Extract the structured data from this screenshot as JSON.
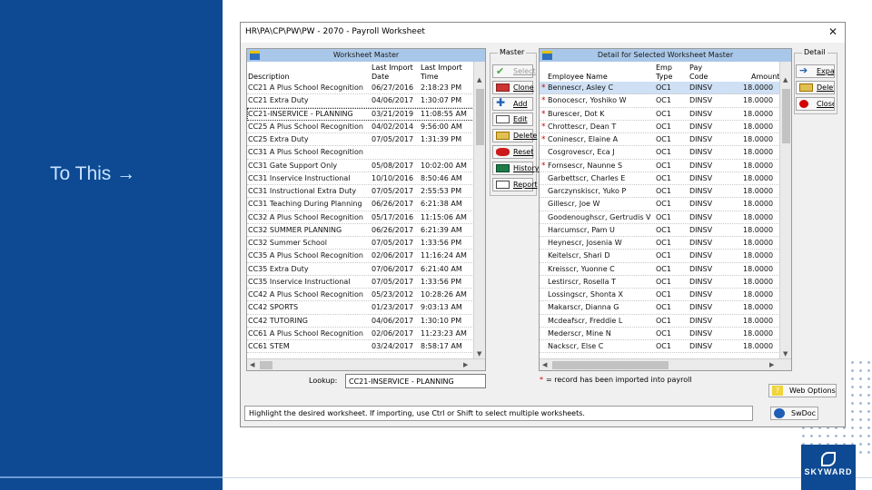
{
  "slide": {
    "caption": "To This",
    "arrow": "→",
    "logo_text": "SKYWARD"
  },
  "window": {
    "title": "HR\\PA\\CP\\PW\\PW - 2070 - Payroll Worksheet",
    "close": "✕"
  },
  "master": {
    "group_label": "Master",
    "grid_title": "Worksheet Master",
    "columns": {
      "description": "Description",
      "last_import_date": "Last Import Date",
      "last_import_time": "Last Import Time"
    },
    "rows": [
      {
        "description": "CC21 A Plus School Recognition",
        "date": "06/27/2016",
        "time": "2:18:23 PM"
      },
      {
        "description": "CC21 Extra Duty",
        "date": "04/06/2017",
        "time": "1:30:07 PM"
      },
      {
        "description": "CC21-INSERVICE - PLANNING",
        "date": "03/21/2019",
        "time": "11:08:55 AM"
      },
      {
        "description": "CC25 A Plus School Recognition",
        "date": "04/02/2014",
        "time": "9:56:00 AM"
      },
      {
        "description": "CC25 Extra Duty",
        "date": "07/05/2017",
        "time": "1:31:39 PM"
      },
      {
        "description": "CC31 A Plus School Recognition",
        "date": "",
        "time": ""
      },
      {
        "description": "CC31 Gate Support Only",
        "date": "05/08/2017",
        "time": "10:02:00 AM"
      },
      {
        "description": "CC31 Inservice Instructional",
        "date": "10/10/2016",
        "time": "8:50:46 AM"
      },
      {
        "description": "CC31 Instructional Extra Duty",
        "date": "07/05/2017",
        "time": "2:55:53 PM"
      },
      {
        "description": "CC31 Teaching During Planning",
        "date": "06/26/2017",
        "time": "6:21:38 AM"
      },
      {
        "description": "CC32 A Plus School Recognition",
        "date": "05/17/2016",
        "time": "11:15:06 AM"
      },
      {
        "description": "CC32 SUMMER PLANNING",
        "date": "06/26/2017",
        "time": "6:21:39 AM"
      },
      {
        "description": "CC32 Summer School",
        "date": "07/05/2017",
        "time": "1:33:56 PM"
      },
      {
        "description": "CC35 A Plus School Recognition",
        "date": "02/06/2017",
        "time": "11:16:24 AM"
      },
      {
        "description": "CC35 Extra Duty",
        "date": "07/06/2017",
        "time": "6:21:40 AM"
      },
      {
        "description": "CC35 Inservice Instructional",
        "date": "07/05/2017",
        "time": "1:33:56 PM"
      },
      {
        "description": "CC42 A Plus School Recognition",
        "date": "05/23/2012",
        "time": "10:28:26 AM"
      },
      {
        "description": "CC42 SPORTS",
        "date": "01/23/2017",
        "time": "9:03:13 AM"
      },
      {
        "description": "CC42 TUTORING",
        "date": "04/06/2017",
        "time": "1:30:10 PM"
      },
      {
        "description": "CC61 A Plus School Recognition",
        "date": "02/06/2017",
        "time": "11:23:23 AM"
      },
      {
        "description": "CC61 STEM",
        "date": "03/24/2017",
        "time": "8:58:17 AM"
      }
    ],
    "buttons": [
      {
        "name": "select-button",
        "label": "Select",
        "icon": "check-icon",
        "disabled": true
      },
      {
        "name": "clone-button",
        "label": "Clone",
        "icon": "clone-icon",
        "disabled": false
      },
      {
        "name": "add-button",
        "label": "Add",
        "icon": "plus-icon",
        "disabled": false
      },
      {
        "name": "edit-button",
        "label": "Edit",
        "icon": "pencil-icon",
        "disabled": false
      },
      {
        "name": "delete-button",
        "label": "Delete",
        "icon": "delete-icon",
        "disabled": false
      },
      {
        "name": "reset-button",
        "label": "Reset",
        "icon": "reset-icon",
        "disabled": false
      },
      {
        "name": "history-button",
        "label": "History",
        "icon": "history-icon",
        "disabled": false
      },
      {
        "name": "report-button",
        "label": "Report",
        "icon": "report-icon",
        "disabled": false
      }
    ],
    "lookup_label": "Lookup:",
    "lookup_value": "CC21-INSERVICE - PLANNING"
  },
  "detail": {
    "group_label": "Detail",
    "grid_title": "Detail for Selected Worksheet Master",
    "columns": {
      "employee_name": "Employee Name",
      "emp_type": "Emp Type",
      "pay_code": "Pay Code",
      "amount": "Amount"
    },
    "rows": [
      {
        "imported": true,
        "name": "Bennescr, Asley C",
        "type": "OC1",
        "code": "DINSV",
        "amount": "18.0000"
      },
      {
        "imported": true,
        "name": "Bonocescr, Yoshiko W",
        "type": "OC1",
        "code": "DINSV",
        "amount": "18.0000"
      },
      {
        "imported": true,
        "name": "Burescer, Dot K",
        "type": "OC1",
        "code": "DINSV",
        "amount": "18.0000"
      },
      {
        "imported": true,
        "name": "Chrottescr, Dean T",
        "type": "OC1",
        "code": "DINSV",
        "amount": "18.0000"
      },
      {
        "imported": true,
        "name": "Coninescr, Elaine A",
        "type": "OC1",
        "code": "DINSV",
        "amount": "18.0000"
      },
      {
        "imported": false,
        "name": "Cosgrovescr, Eca J",
        "type": "OC1",
        "code": "DINSV",
        "amount": "18.0000"
      },
      {
        "imported": true,
        "name": "Fornsescr, Naunne S",
        "type": "OC1",
        "code": "DINSV",
        "amount": "18.0000"
      },
      {
        "imported": false,
        "name": "Garbettscr, Charles E",
        "type": "OC1",
        "code": "DINSV",
        "amount": "18.0000"
      },
      {
        "imported": false,
        "name": "Garczynskiscr, Yuko P",
        "type": "OC1",
        "code": "DINSV",
        "amount": "18.0000"
      },
      {
        "imported": false,
        "name": "Gillescr, Joe W",
        "type": "OC1",
        "code": "DINSV",
        "amount": "18.0000"
      },
      {
        "imported": false,
        "name": "Goodenoughscr, Gertrudis V",
        "type": "OC1",
        "code": "DINSV",
        "amount": "18.0000"
      },
      {
        "imported": false,
        "name": "Harcumscr, Pam U",
        "type": "OC1",
        "code": "DINSV",
        "amount": "18.0000"
      },
      {
        "imported": false,
        "name": "Heynescr, Josenia W",
        "type": "OC1",
        "code": "DINSV",
        "amount": "18.0000"
      },
      {
        "imported": false,
        "name": "Keitelscr, Shari D",
        "type": "OC1",
        "code": "DINSV",
        "amount": "18.0000"
      },
      {
        "imported": false,
        "name": "Kreisscr, Yuonne C",
        "type": "OC1",
        "code": "DINSV",
        "amount": "18.0000"
      },
      {
        "imported": false,
        "name": "Lestirscr, Rosella T",
        "type": "OC1",
        "code": "DINSV",
        "amount": "18.0000"
      },
      {
        "imported": false,
        "name": "Lossingscr, Shonta X",
        "type": "OC1",
        "code": "DINSV",
        "amount": "18.0000"
      },
      {
        "imported": false,
        "name": "Makarscr, Dianna G",
        "type": "OC1",
        "code": "DINSV",
        "amount": "18.0000"
      },
      {
        "imported": false,
        "name": "Mcdeafscr, Freddie L",
        "type": "OC1",
        "code": "DINSV",
        "amount": "18.0000"
      },
      {
        "imported": false,
        "name": "Mederscr, Mine N",
        "type": "OC1",
        "code": "DINSV",
        "amount": "18.0000"
      },
      {
        "imported": false,
        "name": "Nackscr, Else C",
        "type": "OC1",
        "code": "DINSV",
        "amount": "18.0000"
      }
    ],
    "buttons": [
      {
        "name": "expand-button",
        "label": "Expand",
        "icon": "arrow-right-icon"
      },
      {
        "name": "delete-all-button",
        "label": "Delete All",
        "icon": "delete-all-icon"
      },
      {
        "name": "close-button",
        "label": "Close",
        "icon": "close-icon"
      }
    ],
    "legend_star": "*",
    "legend_text": "= record has been imported into payroll"
  },
  "side_buttons": {
    "web_options": "Web Options",
    "swdoc": "SwDoc"
  },
  "status_text": "Highlight the desired worksheet. If importing, use Ctrl or Shift to select multiple worksheets.",
  "colors": {
    "slide_blue": "#0d4a93",
    "grid_header": "#a9c7e8",
    "imported_star": "#d40000"
  }
}
